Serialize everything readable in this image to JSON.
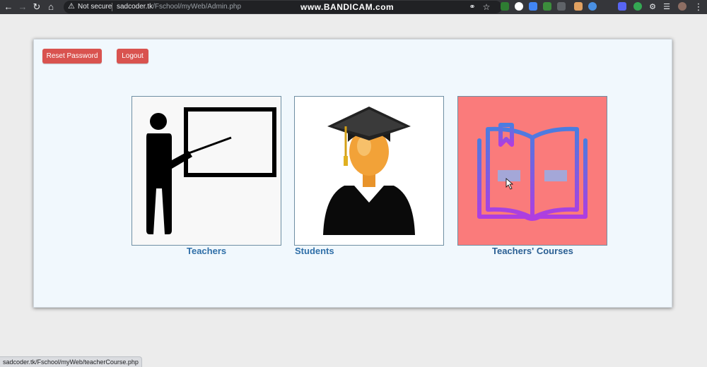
{
  "browser": {
    "security_label": "Not secure",
    "url_host": "sadcoder.tk",
    "url_path": "/Fschool/myWeb/Admin.php",
    "watermark": "www.BANDICAM.com"
  },
  "header": {
    "reset_password_label": "Reset Password",
    "logout_label": "Logout"
  },
  "cards": {
    "teachers": {
      "caption": "Teachers",
      "icon": "teacher-pointing-board-icon"
    },
    "students": {
      "caption": "Students",
      "icon": "graduate-student-icon"
    },
    "courses": {
      "caption": "Teachers' Courses",
      "icon": "open-book-icon"
    }
  },
  "colors": {
    "button": "#d9534f",
    "panel_background": "#f1f8fd",
    "caption": "#2f6fa8",
    "courses_card": "#fa7b7b"
  },
  "status_bar": {
    "link_url": "sadcoder.tk/Fschool/myWeb/teacherCourse.php"
  }
}
